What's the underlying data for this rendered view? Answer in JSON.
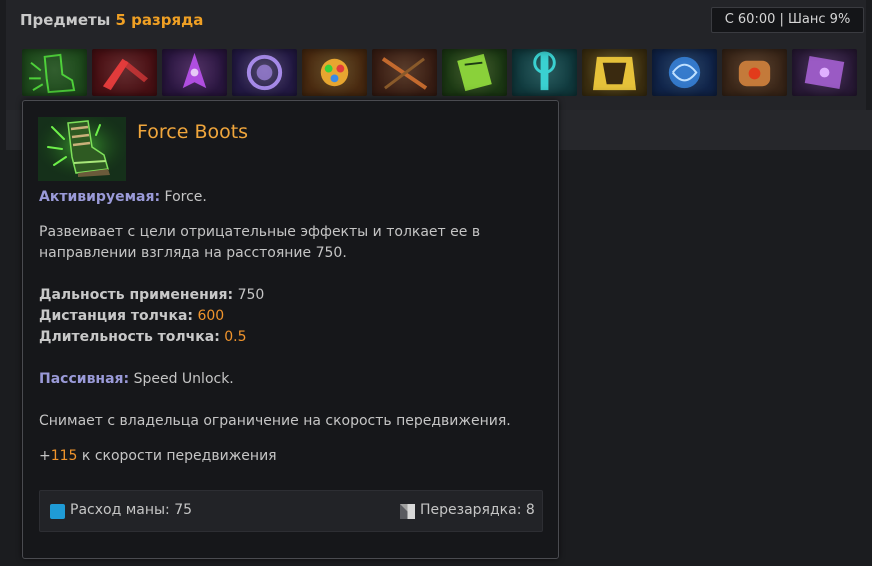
{
  "header": {
    "title_prefix": "Предметы",
    "title_tier": "5 разряда",
    "timer": "С 60:00 | Шанс 9%"
  },
  "items": [
    {
      "name": "force-boots-icon",
      "bg": "#1e4a1c",
      "accent": "#4ed13a"
    },
    {
      "name": "red-claw-item-icon",
      "bg": "#4a1014",
      "accent": "#e23b3b"
    },
    {
      "name": "purple-crystal-item-icon",
      "bg": "#2a1640",
      "accent": "#b04ee0"
    },
    {
      "name": "violet-orb-item-icon",
      "bg": "#241a46",
      "accent": "#a68ae8"
    },
    {
      "name": "golden-amulet-item-icon",
      "bg": "#4a2a10",
      "accent": "#e7a630"
    },
    {
      "name": "crossbow-item-icon",
      "bg": "#3a1e14",
      "accent": "#c46a2e"
    },
    {
      "name": "green-tome-item-icon",
      "bg": "#1c3a14",
      "accent": "#8ad13a"
    },
    {
      "name": "teal-mace-item-icon",
      "bg": "#103a3e",
      "accent": "#3ad1d1"
    },
    {
      "name": "golden-cape-item-icon",
      "bg": "#3e3010",
      "accent": "#e6c23a"
    },
    {
      "name": "blue-vortex-item-icon",
      "bg": "#10244a",
      "accent": "#3a8ae6"
    },
    {
      "name": "stone-gauntlet-item-icon",
      "bg": "#3a2618",
      "accent": "#c47a3a"
    },
    {
      "name": "dark-tome-item-icon",
      "bg": "#2a1a38",
      "accent": "#9a5ac4"
    }
  ],
  "tooltip": {
    "title": "Force Boots",
    "active_label": "Активируемая:",
    "active_name": " Force.",
    "active_desc_1": "Развеивает с цели отрицательные эффекты и толкает ее в",
    "active_desc_2": "направлении взгляда на расстояние 750.",
    "stat1_label": "Дальность применения:",
    "stat1_value": " 750",
    "stat2_label": "Дистанция толчка:",
    "stat2_value": " 600",
    "stat3_label": "Длительность толчка:",
    "stat3_value": " 0.5",
    "passive_label": "Пассивная:",
    "passive_name": " Speed Unlock.",
    "passive_desc": "Снимает с владельца ограничение на скорость передвижения.",
    "bonus_plus": "+",
    "bonus_value": "115",
    "bonus_text": " к скорости передвижения",
    "mana_cost": "Расход маны: 75",
    "cooldown": "Перезарядка: 8"
  },
  "colors": {
    "tier_orange": "#f0a024",
    "title_orange": "#f0a63c",
    "active_label": "#9a9ad8",
    "value_orange": "#f0942c",
    "mana_blue": "#1f9bd6"
  }
}
